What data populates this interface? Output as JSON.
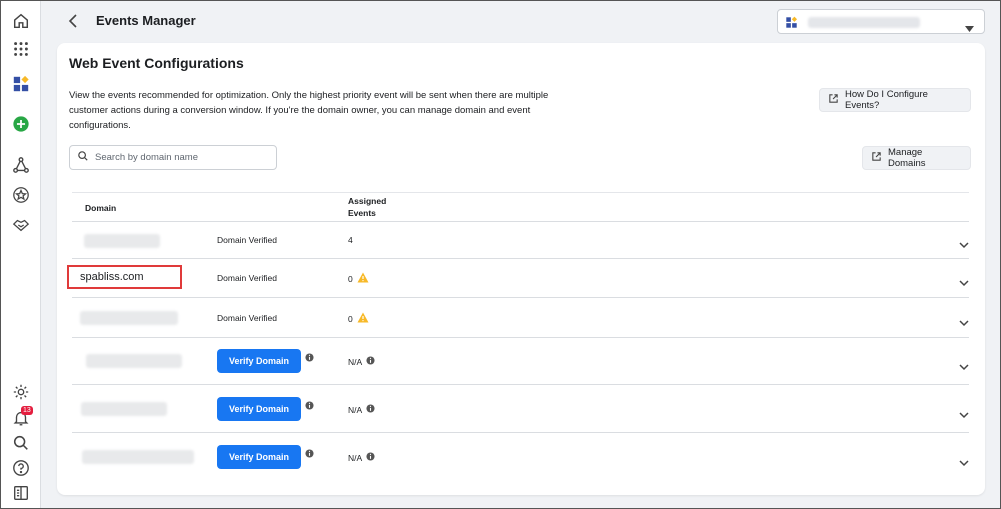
{
  "header": {
    "title": "Events Manager"
  },
  "card": {
    "title": "Web Event Configurations",
    "description": "View the events recommended for optimization. Only the highest priority event will be sent when there are multiple customer actions during a conversion window. If you're the domain owner, you can manage domain and event configurations.",
    "how_button": "How Do I Configure Events?",
    "manage_button": "Manage Domains",
    "search_placeholder": "Search by domain name"
  },
  "table": {
    "col_domain": "Domain",
    "col_assigned": "Assigned Events",
    "rows": [
      {
        "domain": "",
        "status": "Domain Verified",
        "events": "4",
        "warning": false,
        "info": false
      },
      {
        "domain": "spabliss.com",
        "status": "Domain Verified",
        "events": "0",
        "warning": true,
        "info": false
      },
      {
        "domain": "",
        "status": "Domain Verified",
        "events": "0",
        "warning": true,
        "info": false
      },
      {
        "domain": "",
        "status": "Verify Domain",
        "events": "N/A",
        "warning": false,
        "info": true
      },
      {
        "domain": "",
        "status": "Verify Domain",
        "events": "N/A",
        "warning": false,
        "info": true
      },
      {
        "domain": "",
        "status": "Verify Domain",
        "events": "N/A",
        "warning": false,
        "info": true
      }
    ]
  },
  "rail": {
    "notification_count": "13"
  },
  "colors": {
    "accent": "#1877f2",
    "warning": "#f7b928",
    "highlight": "#e03a3a"
  }
}
